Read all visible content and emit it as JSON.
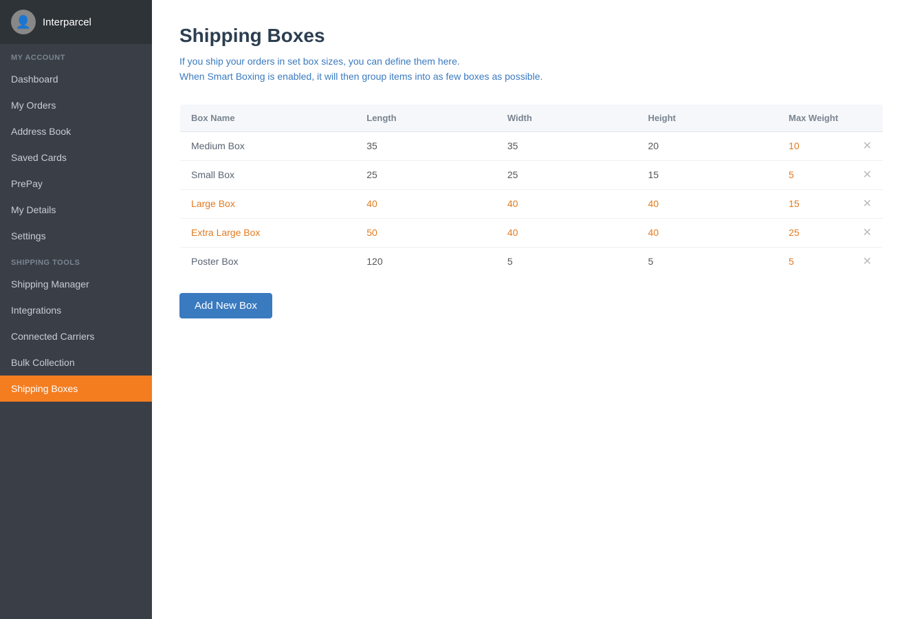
{
  "brand": {
    "name": "Interparcel",
    "avatar_icon": "👤"
  },
  "sidebar": {
    "my_account_label": "MY ACCOUNT",
    "shipping_tools_label": "SHIPPING TOOLS",
    "my_account_items": [
      {
        "id": "dashboard",
        "label": "Dashboard",
        "active": false
      },
      {
        "id": "my-orders",
        "label": "My Orders",
        "active": false
      },
      {
        "id": "address-book",
        "label": "Address Book",
        "active": false
      },
      {
        "id": "saved-cards",
        "label": "Saved Cards",
        "active": false
      },
      {
        "id": "prepay",
        "label": "PrePay",
        "active": false
      },
      {
        "id": "my-details",
        "label": "My Details",
        "active": false
      },
      {
        "id": "settings",
        "label": "Settings",
        "active": false
      }
    ],
    "shipping_tools_items": [
      {
        "id": "shipping-manager",
        "label": "Shipping Manager",
        "active": false
      },
      {
        "id": "integrations",
        "label": "Integrations",
        "active": false
      },
      {
        "id": "connected-carriers",
        "label": "Connected Carriers",
        "active": false
      },
      {
        "id": "bulk-collection",
        "label": "Bulk Collection",
        "active": false
      },
      {
        "id": "shipping-boxes",
        "label": "Shipping Boxes",
        "active": true
      }
    ]
  },
  "main": {
    "title": "Shipping Boxes",
    "subtitle_line1": "If you ship your orders in set box sizes, you can define them here.",
    "subtitle_line2": "When Smart Boxing is enabled, it will then group items into as few boxes as possible.",
    "table": {
      "columns": [
        {
          "id": "box-name",
          "label": "Box Name"
        },
        {
          "id": "length",
          "label": "Length"
        },
        {
          "id": "width",
          "label": "Width"
        },
        {
          "id": "height",
          "label": "Height"
        },
        {
          "id": "max-weight",
          "label": "Max Weight"
        }
      ],
      "rows": [
        {
          "id": "medium-box",
          "name": "Medium Box",
          "length": "35",
          "width": "35",
          "height": "20",
          "max_weight": "10",
          "highlight": false
        },
        {
          "id": "small-box",
          "name": "Small Box",
          "length": "25",
          "width": "25",
          "height": "15",
          "max_weight": "5",
          "highlight": false
        },
        {
          "id": "large-box",
          "name": "Large Box",
          "length": "40",
          "width": "40",
          "height": "40",
          "max_weight": "15",
          "highlight": true
        },
        {
          "id": "extra-large-box",
          "name": "Extra Large Box",
          "length": "50",
          "width": "40",
          "height": "40",
          "max_weight": "25",
          "highlight": true
        },
        {
          "id": "poster-box",
          "name": "Poster Box",
          "length": "120",
          "width": "5",
          "height": "5",
          "max_weight": "5",
          "highlight": false
        }
      ]
    },
    "add_button_label": "Add New Box"
  }
}
